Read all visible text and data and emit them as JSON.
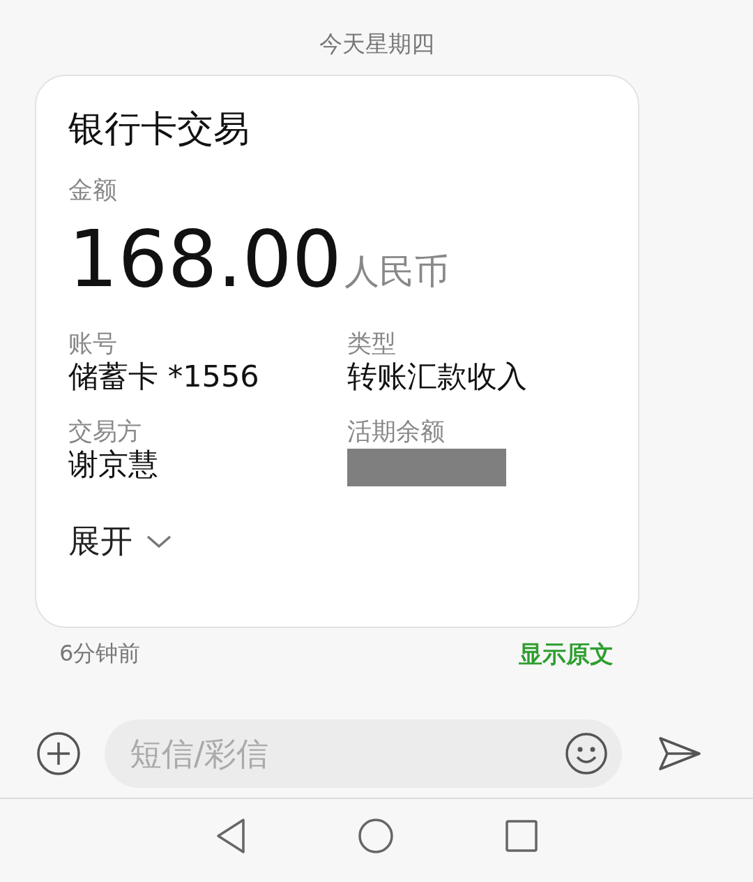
{
  "date_header": "今天星期四",
  "card": {
    "title": "银行卡交易",
    "amount_label": "金额",
    "amount": "168.00",
    "currency": "人民币",
    "fields": [
      {
        "kind": "text",
        "label": "账号",
        "value": "储蓄卡 *1556"
      },
      {
        "kind": "text",
        "label": "类型",
        "value": "转账汇款收入"
      },
      {
        "kind": "text",
        "label": "交易方",
        "value": "谢京慧"
      },
      {
        "kind": "redacted",
        "label": "活期余额"
      }
    ],
    "expand": {
      "label": "展开",
      "expanded": false
    }
  },
  "time": "6分钟前",
  "show_original": "显示原文",
  "composer": {
    "placeholder": "短信/彩信"
  }
}
